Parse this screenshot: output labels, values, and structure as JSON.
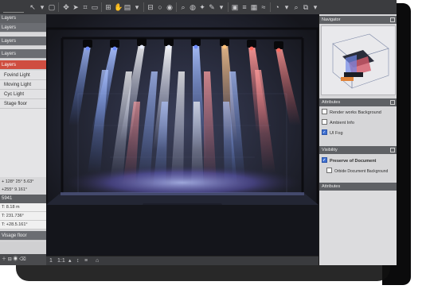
{
  "toolbar": {
    "search_placeholder": ""
  },
  "left_panel": {
    "header": "Layers",
    "tree": [
      {
        "label": "Layers",
        "kind": "dark"
      },
      {
        "label": "Layers",
        "kind": "dark"
      },
      {
        "label": "Layers",
        "kind": "dark"
      },
      {
        "label": "Layers",
        "kind": "sel"
      },
      {
        "label": "Fovind Light",
        "kind": "child"
      },
      {
        "label": "Moving Light",
        "kind": "child"
      },
      {
        "label": "Cyc Light",
        "kind": "child"
      },
      {
        "label": "Stage floor",
        "kind": "child"
      }
    ],
    "props": [
      "+ 128° 25° 5.63°",
      "+255° 9.161°",
      "5941",
      "T: 8.18 m",
      "T: 231.736°",
      "T: +28.5.161°",
      "Visage floor"
    ]
  },
  "navigator": {
    "title": "Navigator"
  },
  "attributes": {
    "title": "Attributes",
    "options": [
      {
        "label": "Render works Background",
        "checked": false
      },
      {
        "label": "Ambient Info",
        "checked": false
      },
      {
        "label": "UI Fog",
        "checked": true
      }
    ]
  },
  "visibility": {
    "title": "Visibility",
    "options": [
      {
        "label": "Preserve of Document",
        "checked": true
      },
      {
        "label": "Orbide Document Background",
        "checked": false
      }
    ]
  },
  "attributes2": {
    "title": "Attributes"
  },
  "viewport_bar": {
    "items": [
      "1",
      "1:1",
      "▴",
      "↕",
      "≡",
      "⌂"
    ]
  },
  "colors": {
    "beam_blue": "#3f6ff0",
    "beam_red": "#e0403a",
    "beam_white": "#e8ecff",
    "beam_amber": "#f09a3a",
    "selection": "#cf4d40",
    "panel": "#d6d6d8"
  }
}
